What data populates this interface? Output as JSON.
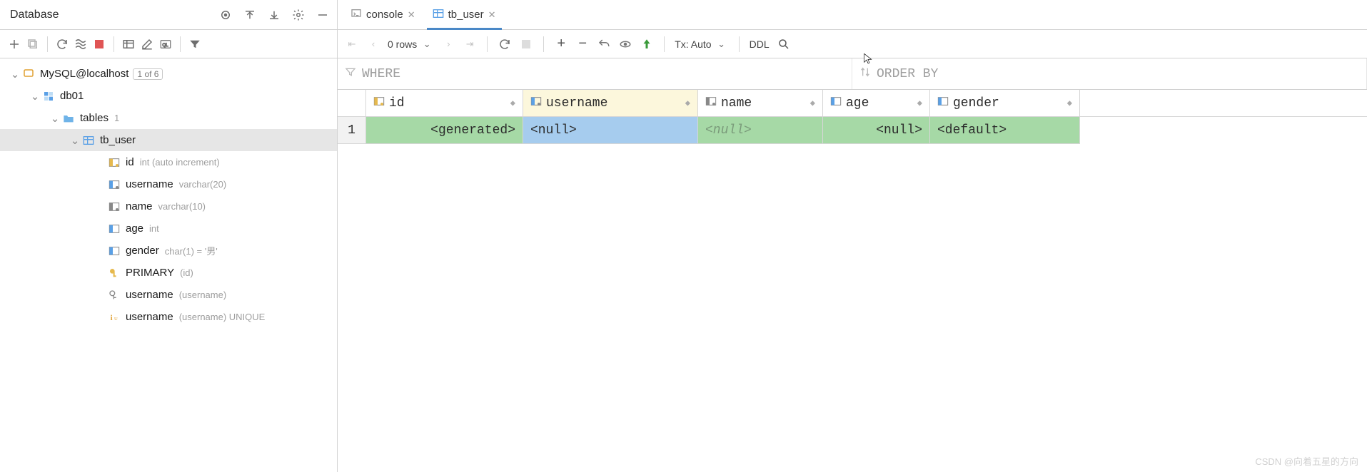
{
  "sidebar": {
    "title": "Database"
  },
  "tree": {
    "root": {
      "label": "MySQL@localhost",
      "badge": "1 of 6"
    },
    "db": {
      "label": "db01"
    },
    "tables": {
      "label": "tables",
      "count": "1"
    },
    "table": {
      "label": "tb_user"
    },
    "columns": [
      {
        "name": "id",
        "ann": "int (auto increment)"
      },
      {
        "name": "username",
        "ann": "varchar(20)"
      },
      {
        "name": "name",
        "ann": "varchar(10)"
      },
      {
        "name": "age",
        "ann": "int"
      },
      {
        "name": "gender",
        "ann": "char(1) = '男'"
      }
    ],
    "keys": [
      {
        "name": "PRIMARY",
        "ann": "(id)"
      },
      {
        "name": "username",
        "ann": "(username)"
      },
      {
        "name": "username",
        "ann": "(username) UNIQUE"
      }
    ]
  },
  "tabs": {
    "console": "console",
    "tb_user": "tb_user"
  },
  "toolbar": {
    "rows": "0 rows",
    "tx": "Tx: Auto",
    "ddl": "DDL"
  },
  "filters": {
    "where": "WHERE",
    "orderby": "ORDER BY"
  },
  "grid": {
    "headers": {
      "id": "id",
      "username": "username",
      "name": "name",
      "age": "age",
      "gender": "gender"
    },
    "row1": {
      "num": "1",
      "id": "<generated>",
      "username": "<null>",
      "name": "<null>",
      "age": "<null>",
      "gender": "<default>"
    }
  },
  "watermark": "CSDN @向着五星的方向"
}
